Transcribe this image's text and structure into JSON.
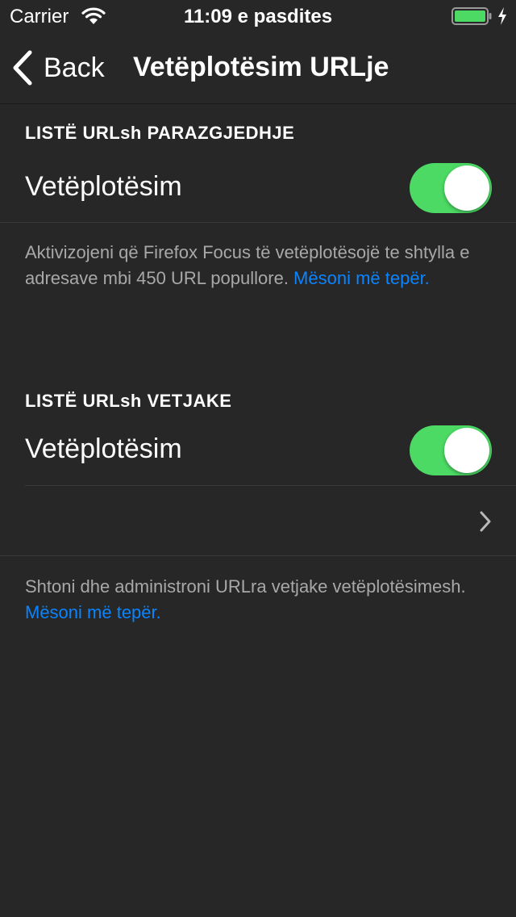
{
  "status_bar": {
    "carrier": "Carrier",
    "time": "11:09 e pasdites",
    "battery_color": "#4cd964"
  },
  "nav": {
    "back_label": "Back",
    "title": "Vetëplotësim URLje"
  },
  "sections": {
    "default_list": {
      "header": "LISTË URLsh PARAZGJEDHJE",
      "row_label": "Vetëplotësim",
      "toggle_on": true,
      "footer_text": "Aktivizojeni që Firefox Focus të vetëplotësojë te shtylla e adresave mbi 450 URL popullore. ",
      "footer_link": "Mësoni më tepër."
    },
    "custom_list": {
      "header": "LISTË URLsh VETJAKE",
      "row_label": "Vetëplotësim",
      "toggle_on": true,
      "footer_text": "Shtoni dhe administroni URLra vetjake vetëplotësimesh. ",
      "footer_link": "Mësoni më tepër."
    }
  },
  "colors": {
    "background": "#272727",
    "toggle_on": "#4cd964",
    "link": "#0a84ff",
    "footer_text": "#a8a8a8"
  }
}
